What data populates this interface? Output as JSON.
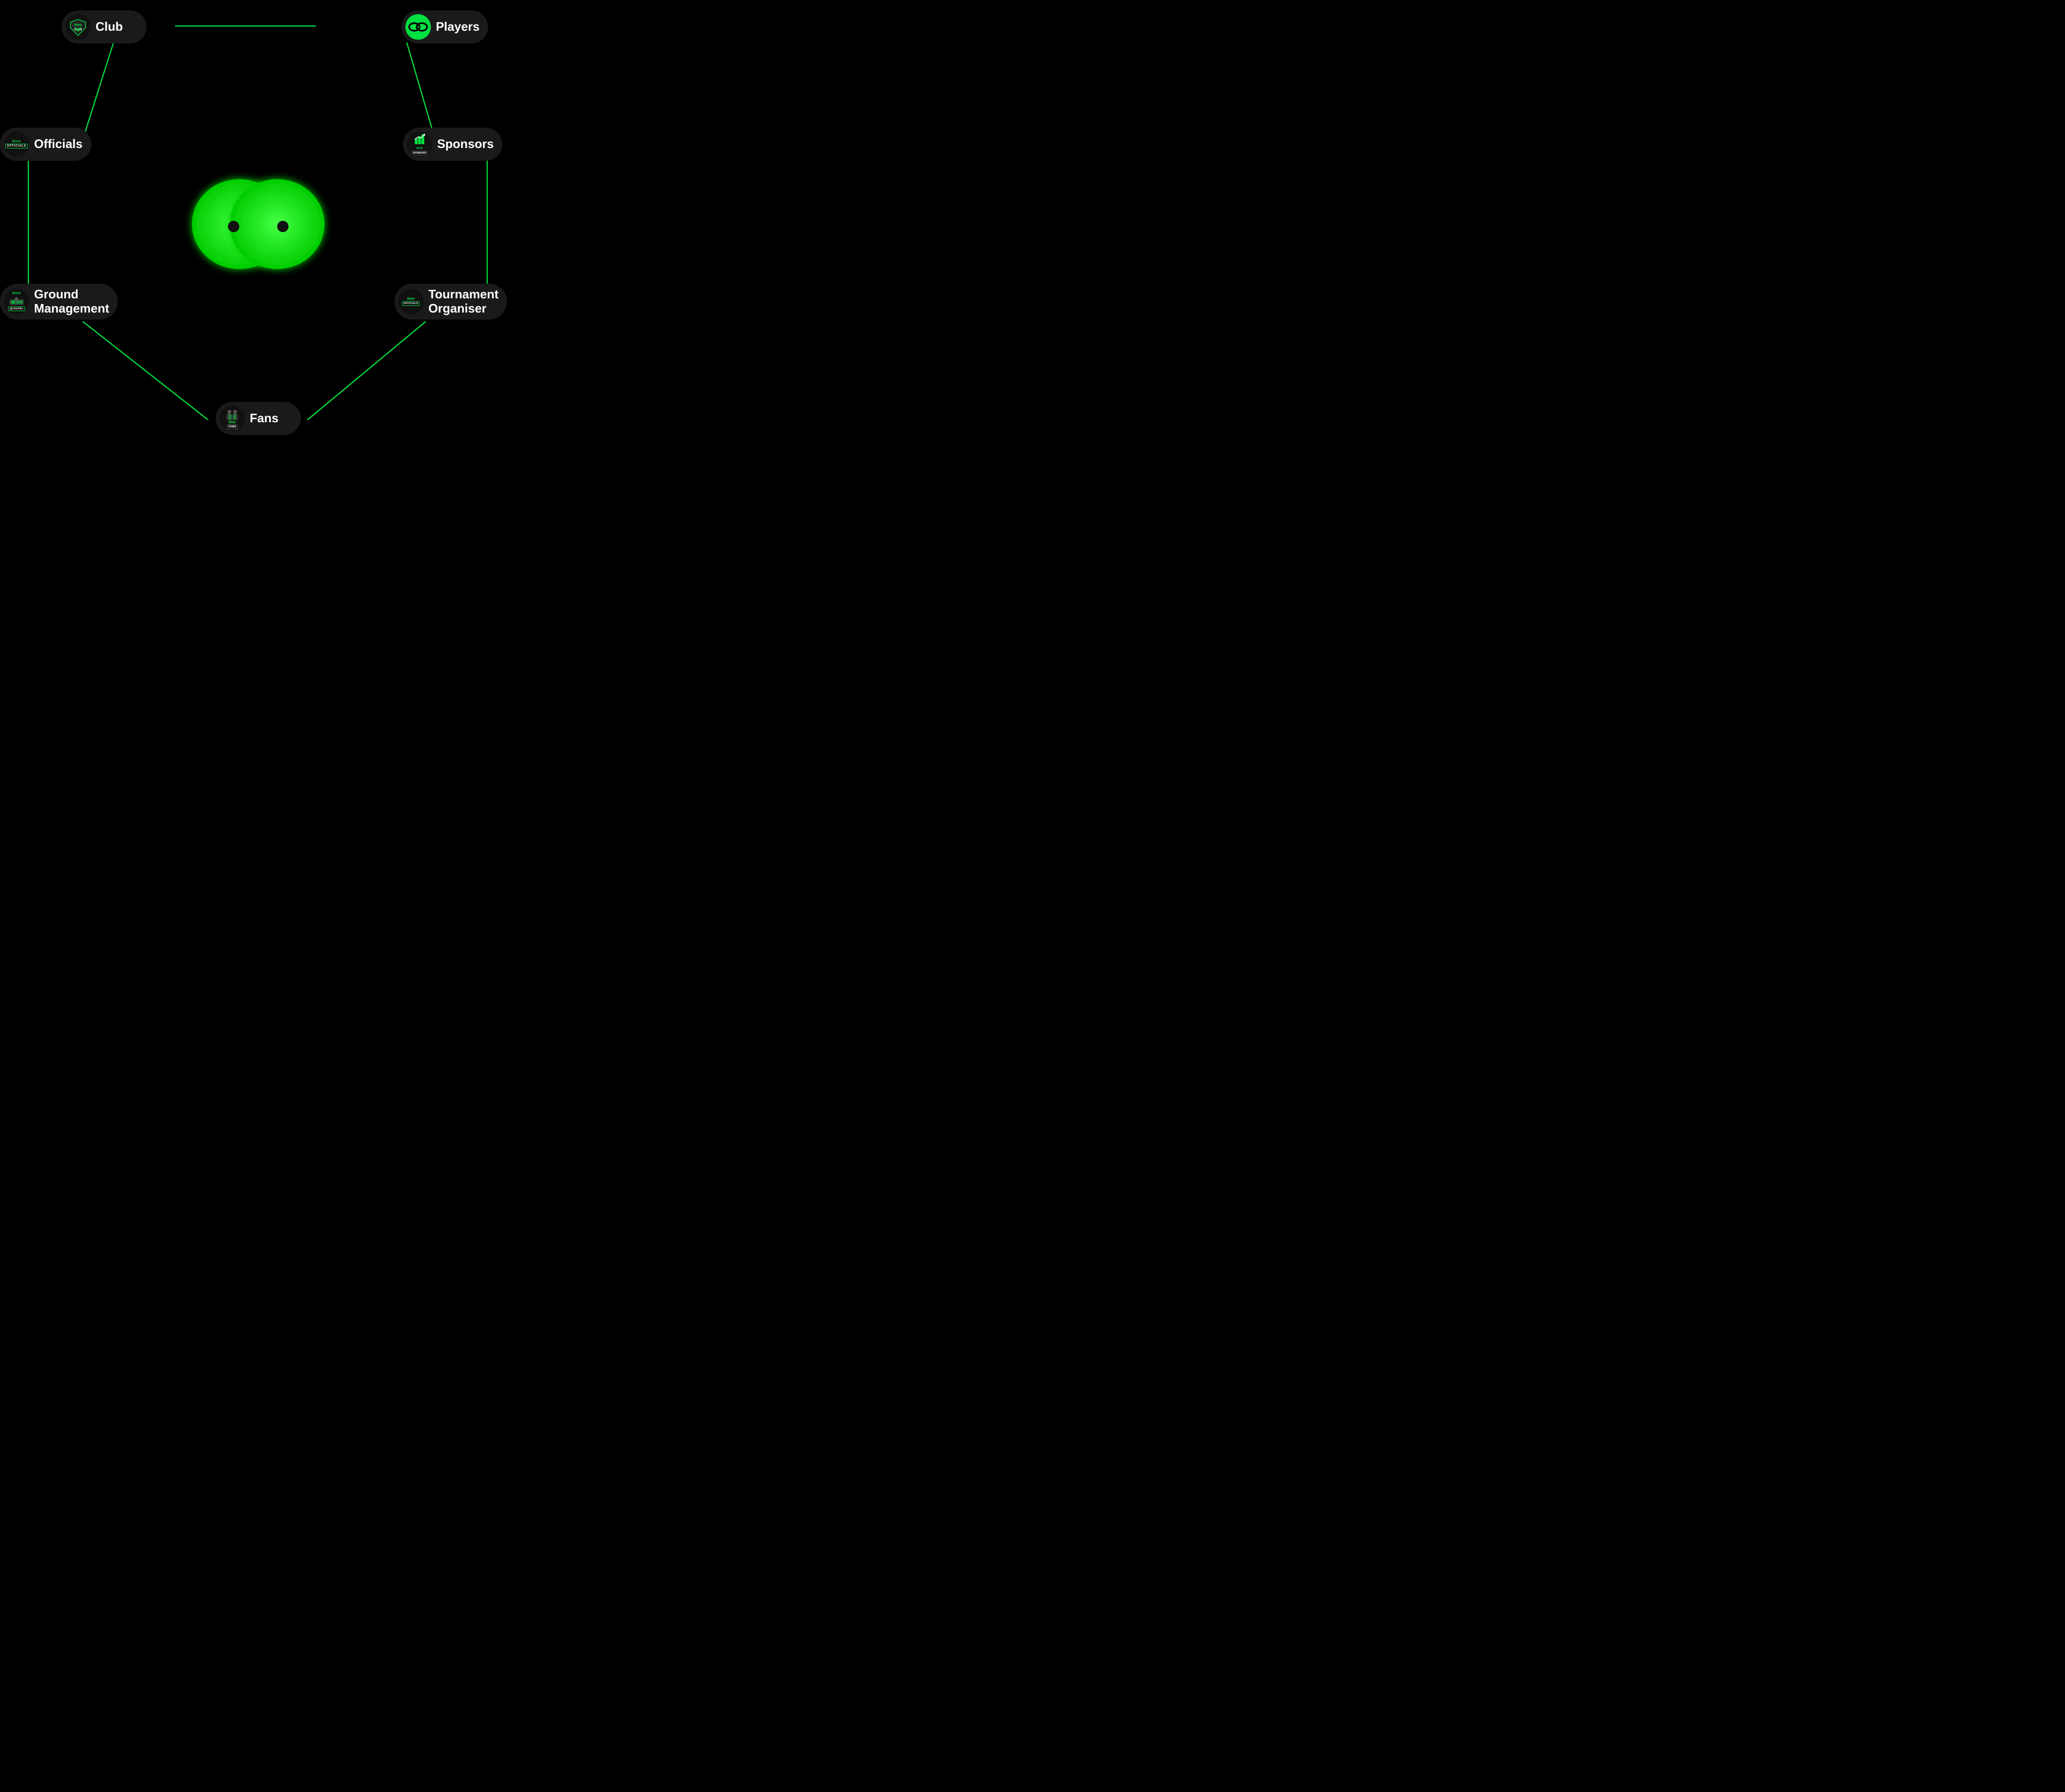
{
  "nodes": {
    "club": {
      "label": "Club"
    },
    "players": {
      "label": "Players"
    },
    "officials": {
      "label": "Officials"
    },
    "sponsors": {
      "label": "Sponsors"
    },
    "ground": {
      "label": "Ground\nManagement"
    },
    "tournament": {
      "label": "Tournament\nOrganiser"
    },
    "fans": {
      "label": "Fans"
    }
  },
  "brand": {
    "name": "8lete",
    "accentColor": "#00e040"
  }
}
